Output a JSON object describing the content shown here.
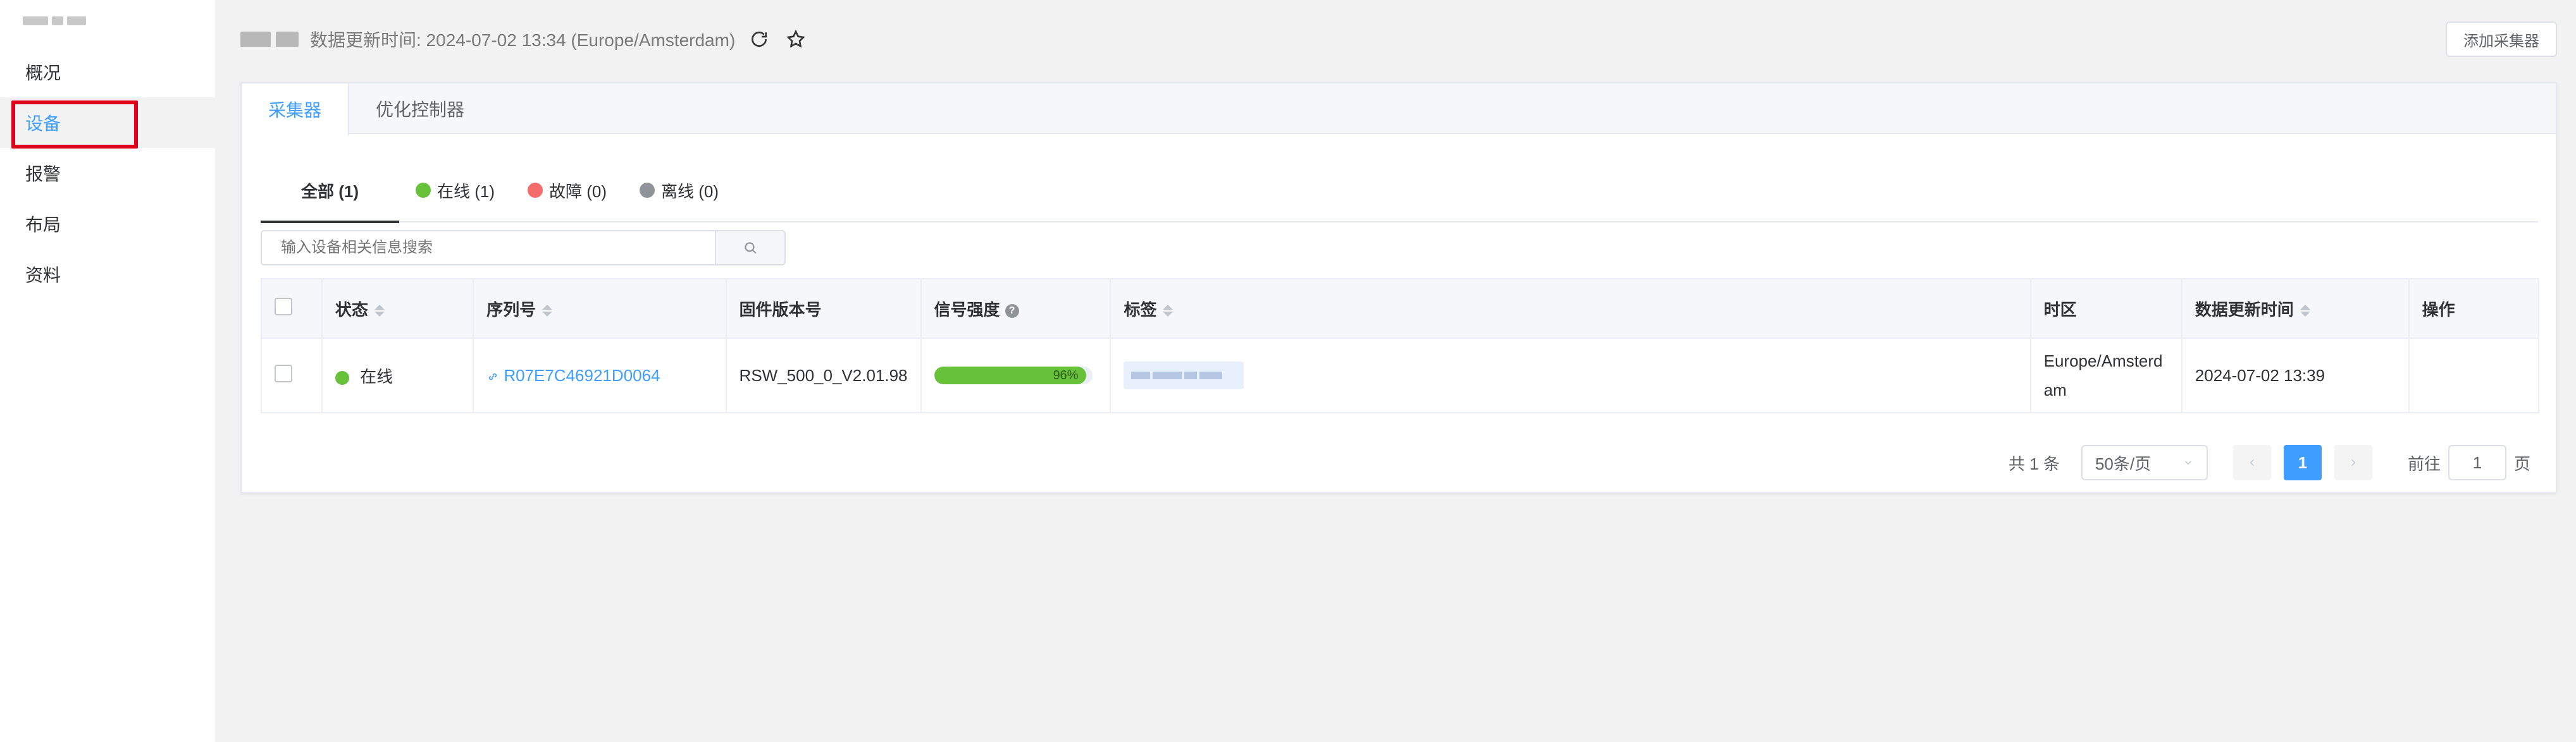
{
  "sidebar": {
    "items": [
      {
        "label": "概况"
      },
      {
        "label": "设备"
      },
      {
        "label": "报警"
      },
      {
        "label": "布局"
      },
      {
        "label": "资料"
      }
    ],
    "active_index": 1
  },
  "header": {
    "update_text": "数据更新时间: 2024-07-02 13:34 (Europe/Amsterdam)",
    "add_button": "添加采集器",
    "icons": [
      "refresh-icon",
      "star-icon"
    ]
  },
  "tabs": [
    {
      "label": "采集器",
      "active": true
    },
    {
      "label": "优化控制器",
      "active": false
    }
  ],
  "filters": [
    {
      "label": "全部 (1)",
      "color": null
    },
    {
      "label": "在线 (1)",
      "color": "#67c23a"
    },
    {
      "label": "故障 (0)",
      "color": "#f56c6c"
    },
    {
      "label": "离线 (0)",
      "color": "#909399"
    }
  ],
  "search": {
    "placeholder": "输入设备相关信息搜索"
  },
  "table": {
    "columns": [
      "状态",
      "序列号",
      "固件版本号",
      "信号强度",
      "标签",
      "时区",
      "数据更新时间",
      "操作"
    ],
    "rows": [
      {
        "status": "在线",
        "status_color": "#67c23a",
        "serial": "R07E7C46921D0064",
        "firmware": "RSW_500_0_V2.01.98",
        "signal_percent": 96,
        "signal_label": "96%",
        "timezone": "Europe/Amsterdam",
        "updated": "2024-07-02 13:39"
      }
    ]
  },
  "pagination": {
    "total_text": "共 1 条",
    "page_size": "50条/页",
    "current_page": "1",
    "goto_label": "前往",
    "goto_value": "1",
    "page_suffix": "页"
  }
}
